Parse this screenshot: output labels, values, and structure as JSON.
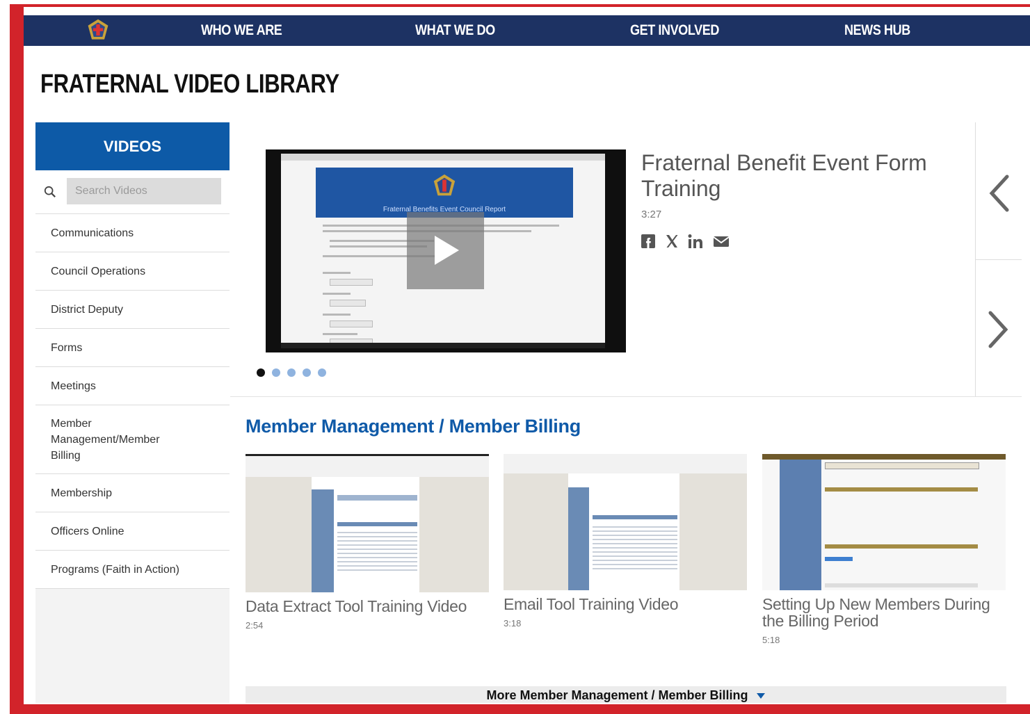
{
  "nav": {
    "logo": "knights-of-columbus-emblem",
    "items": [
      "WHO WE ARE",
      "WHAT WE DO",
      "GET INVOLVED",
      "NEWS HUB"
    ]
  },
  "page": {
    "title": "FRATERNAL VIDEO LIBRARY"
  },
  "sidebar": {
    "header": "VIDEOS",
    "search_placeholder": "Search Videos",
    "categories": [
      "Communications",
      "Council Operations",
      "District Deputy",
      "Forms",
      "Meetings",
      "Member Management/Member Billing",
      "Membership",
      "Officers Online",
      "Programs (Faith in Action)"
    ]
  },
  "featured": {
    "title": "Fraternal Benefit Event Form Training",
    "duration": "3:27",
    "player_banner_text": "Fraternal Benefits Event Council Report",
    "share_icons": [
      "facebook-icon",
      "x-icon",
      "linkedin-icon",
      "email-icon"
    ],
    "slide_count": 5,
    "active_slide": 1
  },
  "section": {
    "title": "Member Management / Member Billing",
    "videos": [
      {
        "title": "Data Extract Tool Training Video",
        "duration": "2:54"
      },
      {
        "title": "Email Tool Training Video",
        "duration": "3:18"
      },
      {
        "title": "Setting Up New Members During the Billing Period",
        "duration": "5:18"
      }
    ],
    "more_label": "More Member Management / Member Billing"
  },
  "colors": {
    "frame": "#d2232a",
    "nav_bg": "#1d3263",
    "accent_blue": "#0d5aa7"
  }
}
